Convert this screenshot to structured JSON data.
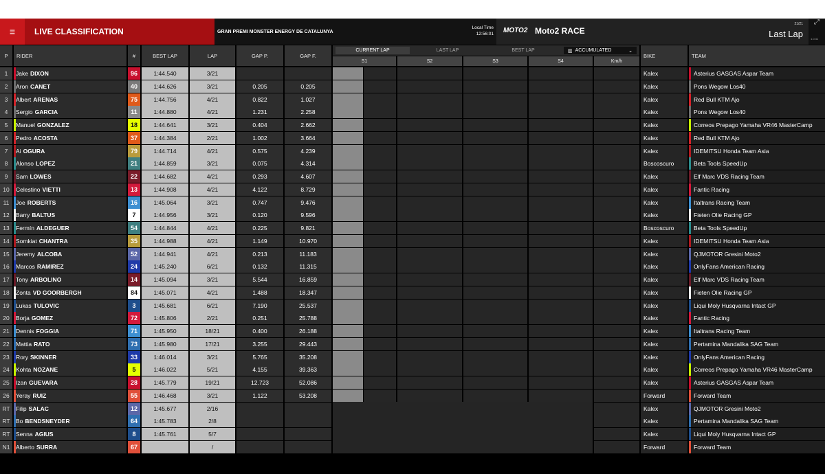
{
  "header": {
    "menu_icon": "≡",
    "live_title": "LIVE CLASSIFICATION",
    "event": "GRAN PREMI MONSTER ENERGY DE CATALUNYA",
    "local_time_label": "Local Time",
    "local_time": "12:56:01",
    "brand": "MOTO2",
    "race_title": "Moto2 RACE",
    "lap_counter": "21/21",
    "last_lap": "Last Lap",
    "version": "1.0.41"
  },
  "columns": {
    "pos": "P",
    "rider": "RIDER",
    "num": "#",
    "best_lap": "BEST LAP",
    "lap": "LAP",
    "gap_p": "GAP P.",
    "gap_f": "GAP F.",
    "bike": "BIKE",
    "team": "TEAM",
    "lap_tabs": [
      "CURRENT LAP",
      "LAST LAP",
      "BEST LAP"
    ],
    "accumulated": "ACCUMULATED",
    "sectors": [
      "S1",
      "S2",
      "S3",
      "S4",
      "Km/h"
    ]
  },
  "rows": [
    {
      "pos": "1",
      "first": "Jake",
      "last": "DIXON",
      "num": "96",
      "num_bg": "#c8102e",
      "num_fg": "#fff",
      "team_color": "#c8102e",
      "best": "1:44.540",
      "lap": "3/21",
      "gap_p": "",
      "gap_f": "",
      "bike": "Kalex",
      "team": "Asterius GASGAS Aspar Team"
    },
    {
      "pos": "2",
      "first": "Aron",
      "last": "CANET",
      "num": "40",
      "num_bg": "#7a7a7a",
      "num_fg": "#fff",
      "team_color": "#6d6d6d",
      "best": "1:44.626",
      "lap": "3/21",
      "gap_p": "0.205",
      "gap_f": "0.205",
      "bike": "Kalex",
      "team": "Pons Wegow Los40"
    },
    {
      "pos": "3",
      "first": "Albert",
      "last": "ARENAS",
      "num": "75",
      "num_bg": "#e05a1a",
      "num_fg": "#fff",
      "team_color": "#d2232a",
      "best": "1:44.756",
      "lap": "4/21",
      "gap_p": "0.822",
      "gap_f": "1.027",
      "bike": "Kalex",
      "team": "Red Bull KTM Ajo"
    },
    {
      "pos": "4",
      "first": "Sergio",
      "last": "GARCIA",
      "num": "11",
      "num_bg": "#8a8a8a",
      "num_fg": "#fff",
      "team_color": "#6d6d6d",
      "best": "1:44.880",
      "lap": "4/21",
      "gap_p": "1.231",
      "gap_f": "2.258",
      "bike": "Kalex",
      "team": "Pons Wegow Los40"
    },
    {
      "pos": "5",
      "first": "Manuel",
      "last": "GONZALEZ",
      "num": "18",
      "num_bg": "#e5ff00",
      "num_fg": "#111",
      "team_color": "#c6f000",
      "best": "1:44.641",
      "lap": "3/21",
      "gap_p": "0.404",
      "gap_f": "2.662",
      "bike": "Kalex",
      "team": "Correos Prepago Yamaha VR46 MasterCamp"
    },
    {
      "pos": "6",
      "first": "Pedro",
      "last": "ACOSTA",
      "num": "37",
      "num_bg": "#e05a1a",
      "num_fg": "#fff",
      "team_color": "#d2232a",
      "best": "1:44.384",
      "lap": "2/21",
      "gap_p": "1.002",
      "gap_f": "3.664",
      "bike": "Kalex",
      "team": "Red Bull KTM Ajo"
    },
    {
      "pos": "7",
      "first": "Ai",
      "last": "OGURA",
      "num": "79",
      "num_bg": "#b89b3c",
      "num_fg": "#fff",
      "team_color": "#b11a20",
      "best": "1:44.714",
      "lap": "4/21",
      "gap_p": "0.575",
      "gap_f": "4.239",
      "bike": "Kalex",
      "team": "IDEMITSU Honda Team Asia"
    },
    {
      "pos": "8",
      "first": "Alonso",
      "last": "LOPEZ",
      "num": "21",
      "num_bg": "#3f7f80",
      "num_fg": "#fff",
      "team_color": "#2c8c8c",
      "best": "1:44.859",
      "lap": "3/21",
      "gap_p": "0.075",
      "gap_f": "4.314",
      "bike": "Boscoscuro",
      "team": "Beta Tools SpeedUp"
    },
    {
      "pos": "9",
      "first": "Sam",
      "last": "LOWES",
      "num": "22",
      "num_bg": "#7a1c2a",
      "num_fg": "#fff",
      "team_color": "#6a1b28",
      "best": "1:44.682",
      "lap": "4/21",
      "gap_p": "0.293",
      "gap_f": "4.607",
      "bike": "Kalex",
      "team": "Elf Marc VDS Racing Team"
    },
    {
      "pos": "10",
      "first": "Celestino",
      "last": "VIETTI",
      "num": "13",
      "num_bg": "#d31a3c",
      "num_fg": "#fff",
      "team_color": "#d31a3c",
      "best": "1:44.908",
      "lap": "4/21",
      "gap_p": "4.122",
      "gap_f": "8.729",
      "bike": "Kalex",
      "team": "Fantic Racing"
    },
    {
      "pos": "11",
      "first": "Joe",
      "last": "ROBERTS",
      "num": "16",
      "num_bg": "#3d8fd1",
      "num_fg": "#fff",
      "team_color": "#3d8fd1",
      "best": "1:45.064",
      "lap": "3/21",
      "gap_p": "0.747",
      "gap_f": "9.476",
      "bike": "Kalex",
      "team": "Italtrans Racing Team"
    },
    {
      "pos": "12",
      "first": "Barry",
      "last": "BALTUS",
      "num": "7",
      "num_bg": "#ffffff",
      "num_fg": "#111",
      "team_color": "#eeeeee",
      "best": "1:44.956",
      "lap": "3/21",
      "gap_p": "0.120",
      "gap_f": "9.596",
      "bike": "Kalex",
      "team": "Fieten Olie Racing GP"
    },
    {
      "pos": "13",
      "first": "Fermín",
      "last": "ALDEGUER",
      "num": "54",
      "num_bg": "#3f7f80",
      "num_fg": "#fff",
      "team_color": "#2c8c8c",
      "best": "1:44.844",
      "lap": "4/21",
      "gap_p": "0.225",
      "gap_f": "9.821",
      "bike": "Boscoscuro",
      "team": "Beta Tools SpeedUp"
    },
    {
      "pos": "14",
      "first": "Somkiat",
      "last": "CHANTRA",
      "num": "35",
      "num_bg": "#b89b3c",
      "num_fg": "#fff",
      "team_color": "#b11a20",
      "best": "1:44.988",
      "lap": "4/21",
      "gap_p": "1.149",
      "gap_f": "10.970",
      "bike": "Kalex",
      "team": "IDEMITSU Honda Team Asia"
    },
    {
      "pos": "15",
      "first": "Jeremy",
      "last": "ALCOBA",
      "num": "52",
      "num_bg": "#5b67a8",
      "num_fg": "#fff",
      "team_color": "#5b67a8",
      "best": "1:44.941",
      "lap": "4/21",
      "gap_p": "0.213",
      "gap_f": "11.183",
      "bike": "Kalex",
      "team": "QJMOTOR Gresini Moto2"
    },
    {
      "pos": "16",
      "first": "Marcos",
      "last": "RAMIREZ",
      "num": "24",
      "num_bg": "#1f3aa8",
      "num_fg": "#fff",
      "team_color": "#1f3aa8",
      "best": "1:45.240",
      "lap": "6/21",
      "gap_p": "0.132",
      "gap_f": "11.315",
      "bike": "Kalex",
      "team": "OnlyFans American Racing"
    },
    {
      "pos": "17",
      "first": "Tony",
      "last": "ARBOLINO",
      "num": "14",
      "num_bg": "#7a1c2a",
      "num_fg": "#fff",
      "team_color": "#6a1b28",
      "best": "1:45.094",
      "lap": "3/21",
      "gap_p": "5.544",
      "gap_f": "16.859",
      "bike": "Kalex",
      "team": "Elf Marc VDS Racing Team"
    },
    {
      "pos": "18",
      "first": "Zonta",
      "last": "VD GOORBERGH",
      "num": "84",
      "num_bg": "#ffffff",
      "num_fg": "#111",
      "team_color": "#eeeeee",
      "best": "1:45.071",
      "lap": "4/21",
      "gap_p": "1.488",
      "gap_f": "18.347",
      "bike": "Kalex",
      "team": "Fieten Olie Racing GP"
    },
    {
      "pos": "19",
      "first": "Lukas",
      "last": "TULOVIC",
      "num": "3",
      "num_bg": "#1e4e8c",
      "num_fg": "#fff",
      "team_color": "#1e4e8c",
      "best": "1:45.681",
      "lap": "6/21",
      "gap_p": "7.190",
      "gap_f": "25.537",
      "bike": "Kalex",
      "team": "Liqui Moly Husqvarna Intact GP"
    },
    {
      "pos": "20",
      "first": "Borja",
      "last": "GOMEZ",
      "num": "72",
      "num_bg": "#d31a3c",
      "num_fg": "#fff",
      "team_color": "#d31a3c",
      "best": "1:45.806",
      "lap": "2/21",
      "gap_p": "0.251",
      "gap_f": "25.788",
      "bike": "Kalex",
      "team": "Fantic Racing"
    },
    {
      "pos": "21",
      "first": "Dennis",
      "last": "FOGGIA",
      "num": "71",
      "num_bg": "#3d8fd1",
      "num_fg": "#fff",
      "team_color": "#3d8fd1",
      "best": "1:45.950",
      "lap": "18/21",
      "gap_p": "0.400",
      "gap_f": "26.188",
      "bike": "Kalex",
      "team": "Italtrans Racing Team"
    },
    {
      "pos": "22",
      "first": "Mattia",
      "last": "RATO",
      "num": "73",
      "num_bg": "#2f6fb0",
      "num_fg": "#fff",
      "team_color": "#2f6fb0",
      "best": "1:45.980",
      "lap": "17/21",
      "gap_p": "3.255",
      "gap_f": "29.443",
      "bike": "Kalex",
      "team": "Pertamina Mandalika SAG Team"
    },
    {
      "pos": "23",
      "first": "Rory",
      "last": "SKINNER",
      "num": "33",
      "num_bg": "#1f3aa8",
      "num_fg": "#fff",
      "team_color": "#1f3aa8",
      "best": "1:46.014",
      "lap": "3/21",
      "gap_p": "5.765",
      "gap_f": "35.208",
      "bike": "Kalex",
      "team": "OnlyFans American Racing"
    },
    {
      "pos": "24",
      "first": "Kohta",
      "last": "NOZANE",
      "num": "5",
      "num_bg": "#e5ff00",
      "num_fg": "#111",
      "team_color": "#c6f000",
      "best": "1:46.022",
      "lap": "5/21",
      "gap_p": "4.155",
      "gap_f": "39.363",
      "bike": "Kalex",
      "team": "Correos Prepago Yamaha VR46 MasterCamp"
    },
    {
      "pos": "25",
      "first": "Izan",
      "last": "GUEVARA",
      "num": "28",
      "num_bg": "#c8102e",
      "num_fg": "#fff",
      "team_color": "#c8102e",
      "best": "1:45.779",
      "lap": "19/21",
      "gap_p": "12.723",
      "gap_f": "52.086",
      "bike": "Kalex",
      "team": "Asterius GASGAS Aspar Team"
    },
    {
      "pos": "26",
      "first": "Yeray",
      "last": "RUIZ",
      "num": "55",
      "num_bg": "#e0503a",
      "num_fg": "#fff",
      "team_color": "#e0503a",
      "best": "1:46.468",
      "lap": "3/21",
      "gap_p": "1.122",
      "gap_f": "53.208",
      "bike": "Forward",
      "team": "Forward Team"
    },
    {
      "pos": "RT",
      "first": "Filip",
      "last": "SALAC",
      "num": "12",
      "num_bg": "#5b67a8",
      "num_fg": "#fff",
      "team_color": "#5b67a8",
      "best": "1:45.677",
      "lap": "2/16",
      "gap_p": "",
      "gap_f": "",
      "bike": "Kalex",
      "team": "QJMOTOR Gresini Moto2"
    },
    {
      "pos": "RT",
      "first": "Bo",
      "last": "BENDSNEYDER",
      "num": "64",
      "num_bg": "#2f6fb0",
      "num_fg": "#fff",
      "team_color": "#2f6fb0",
      "best": "1:45.783",
      "lap": "2/8",
      "gap_p": "",
      "gap_f": "",
      "bike": "Kalex",
      "team": "Pertamina Mandalika SAG Team"
    },
    {
      "pos": "RT",
      "first": "Senna",
      "last": "AGIUS",
      "num": "8",
      "num_bg": "#1e4e8c",
      "num_fg": "#fff",
      "team_color": "#1e4e8c",
      "best": "1:45.761",
      "lap": "5/7",
      "gap_p": "",
      "gap_f": "",
      "bike": "Kalex",
      "team": "Liqui Moly Husqvarna Intact GP"
    },
    {
      "pos": "N1",
      "first": "Alberto",
      "last": "SURRA",
      "num": "67",
      "num_bg": "#e0503a",
      "num_fg": "#fff",
      "team_color": "#e0503a",
      "best": "",
      "lap": "/",
      "gap_p": "",
      "gap_f": "",
      "bike": "Forward",
      "team": "Forward Team"
    }
  ]
}
